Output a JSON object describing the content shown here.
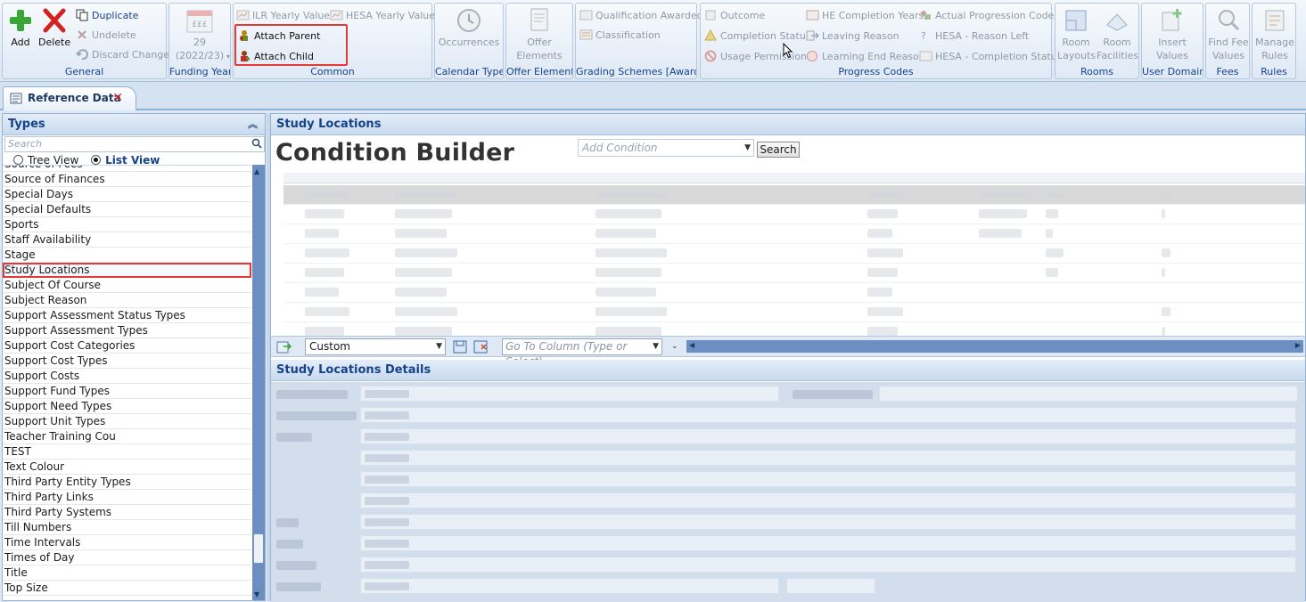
{
  "ribbon": {
    "general": {
      "label": "General",
      "add": "Add",
      "delete": "Delete",
      "duplicate": "Duplicate",
      "undelete": "Undelete",
      "discard": "Discard Changes"
    },
    "funding_year": {
      "label": "Funding Year",
      "line1": "29",
      "line2": "(2022/23)",
      "icon_text": "£££"
    },
    "common": {
      "label": "Common",
      "ilr": "ILR Yearly Values",
      "hesa": "HESA Yearly Values",
      "attach_parent": "Attach Parent",
      "attach_child": "Attach Child"
    },
    "calendar": {
      "label": "Calendar Types",
      "occurrences": "Occurrences"
    },
    "offer": {
      "label": "Offer Elements",
      "offer_line1": "Offer",
      "offer_line2": "Elements"
    },
    "grading": {
      "label": "Grading Schemes [Awards]",
      "qualification": "Qualification Awarded",
      "classification": "Classification"
    },
    "progress": {
      "label": "Progress Codes",
      "outcome": "Outcome",
      "completion": "Completion Status",
      "usage": "Usage Permissions",
      "he_completion": "HE Completion Years",
      "leaving": "Leaving Reason",
      "learning_end": "Learning End Reason",
      "actual_progression": "Actual Progression Codes",
      "hesa_reason": "HESA - Reason Left",
      "hesa_completion": "HESA - Completion Status"
    },
    "rooms": {
      "label": "Rooms",
      "layouts_1": "Room",
      "layouts_2": "Layouts",
      "facilities_1": "Room",
      "facilities_2": "Facilities"
    },
    "user_domains": {
      "label": "User Domains",
      "insert_1": "Insert",
      "insert_2": "Values"
    },
    "fees": {
      "label": "Fees",
      "find_1": "Find Fee",
      "find_2": "Values"
    },
    "rules": {
      "label": "Rules",
      "manage_1": "Manage",
      "manage_2": "Rules"
    }
  },
  "tab": {
    "title": "Reference Data",
    "close": "✕"
  },
  "types_panel": {
    "title": "Types",
    "search_placeholder": "Search",
    "tree_view": "Tree View",
    "list_view": "List View",
    "items": [
      "Source of Fees",
      "Source of Finances",
      "Special Days",
      "Special Defaults",
      "Sports",
      "Staff Availability",
      "Stage",
      "Study Locations",
      "Subject Of Course",
      "Subject Reason",
      "Support Assessment Status Types",
      "Support Assessment Types",
      "Support Cost Categories",
      "Support Cost Types",
      "Support Costs",
      "Support Fund Types",
      "Support Need Types",
      "Support Unit Types",
      "Teacher Training Cou",
      "TEST",
      "Text Colour",
      "Third Party Entity Types",
      "Third Party Links",
      "Third Party Systems",
      "Till Numbers",
      "Time Intervals",
      "Times of Day",
      "Title",
      "Top Size"
    ],
    "selected_index": 7
  },
  "main": {
    "header": "Study Locations",
    "condition_builder": "Condition Builder",
    "add_condition_placeholder": "Add Condition",
    "search_button": "Search",
    "layout_value": "Custom",
    "goto_placeholder": "Go To Column (Type or Select)",
    "details_header": "Study Locations Details"
  },
  "colors": {
    "accent": "#15428b",
    "highlight": "#e53935",
    "scroll": "#6a8fc0"
  }
}
